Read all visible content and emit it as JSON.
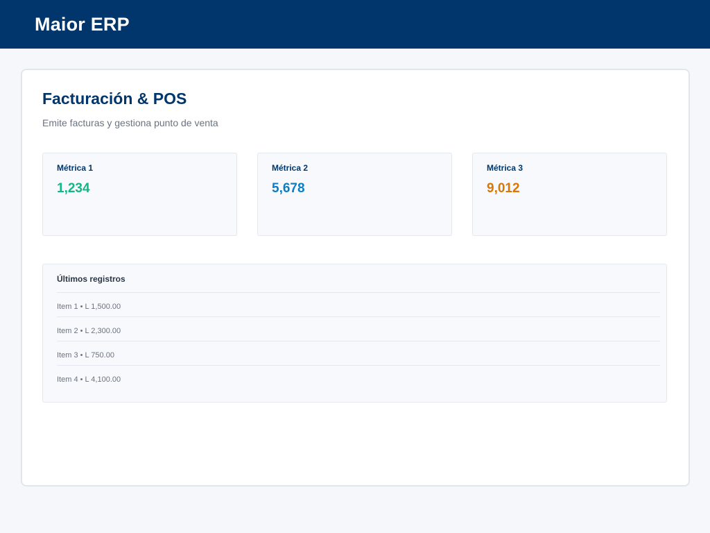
{
  "header": {
    "brand": "Maior ERP"
  },
  "page": {
    "title": "Facturación & POS",
    "subtitle": "Emite facturas y gestiona punto de venta"
  },
  "metrics": [
    {
      "label": "Métrica 1",
      "value": "1,234",
      "color": "#10b981"
    },
    {
      "label": "Métrica 2",
      "value": "5,678",
      "color": "#0b7ec4"
    },
    {
      "label": "Métrica 3",
      "value": "9,012",
      "color": "#d97706"
    }
  ],
  "records": {
    "title": "Últimos registros",
    "items": [
      "Item 1 • L 1,500.00",
      "Item 2 • L 2,300.00",
      "Item 3 • L 750.00",
      "Item 4 • L 4,100.00"
    ]
  },
  "colors": {
    "brand": "#00366b",
    "background": "#f5f7fb"
  }
}
